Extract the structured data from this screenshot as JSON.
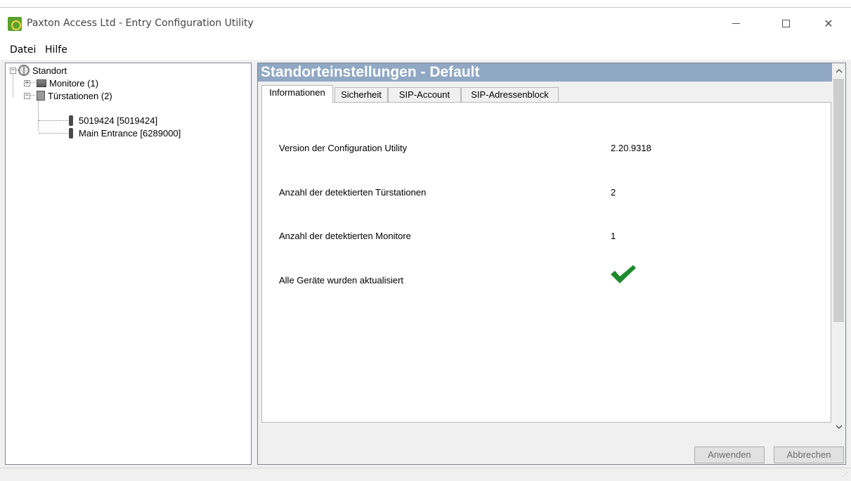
{
  "window": {
    "title": "Paxton Access Ltd - Entry Configuration Utility",
    "controls": {
      "minimize": "minimize-icon",
      "maximize": "maximize-icon",
      "close": "close-icon"
    }
  },
  "menu": {
    "file": "Datei",
    "help": "Hilfe"
  },
  "tree": {
    "root": "Standort",
    "monitors": "Monitore (1)",
    "door_stations": "Türstationen (2)",
    "stations": [
      "5019424 [5019424]",
      "Main Entrance [6289000]"
    ],
    "expanders": {
      "root": "−",
      "monitors": "+",
      "door_stations": "−"
    }
  },
  "panel": {
    "header": "Standorteinstellungen - Default",
    "header_color": "#90a8c4",
    "tabs": [
      "Informationen",
      "Sicherheit",
      "SIP-Account",
      "SIP-Adressenblock"
    ],
    "active_tab": "Informationen"
  },
  "info": {
    "rows": [
      {
        "label": "Version der Configuration Utility",
        "value": "2.20.9318"
      },
      {
        "label": "Anzahl der detektierten Türstationen",
        "value": "2"
      },
      {
        "label": "Anzahl der detektierten Monitore",
        "value": "1"
      },
      {
        "label": "Alle Geräte wurden aktualisiert",
        "icon": "checkmark-icon",
        "icon_color": "#1e8a2e"
      }
    ]
  },
  "buttons": {
    "apply": "Anwenden",
    "cancel": "Abbrechen"
  },
  "scrollbar": {
    "up": "▲",
    "down": "▼"
  }
}
